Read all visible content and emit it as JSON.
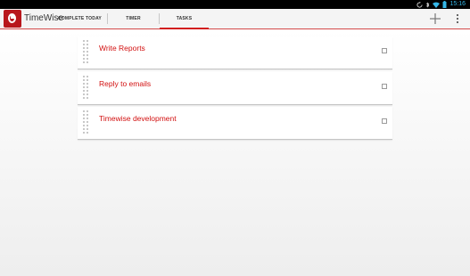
{
  "status_bar": {
    "time": "15:16",
    "icons": [
      "sync-icon",
      "bluetooth-icon",
      "wifi-icon",
      "battery-icon"
    ]
  },
  "app": {
    "title": "TimeWise",
    "accent_color": "#d21e1e"
  },
  "tabs": [
    {
      "label": "COMPLETE TODAY",
      "active": false
    },
    {
      "label": "TIMER",
      "active": false
    },
    {
      "label": "TASKS",
      "active": true
    }
  ],
  "actions": {
    "add_icon": "plus-icon",
    "overflow_icon": "vertical-dots-icon"
  },
  "tasks": [
    {
      "title": "Write Reports",
      "checked": false
    },
    {
      "title": "Reply to emails",
      "checked": false
    },
    {
      "title": "Timewise development",
      "checked": false
    }
  ]
}
